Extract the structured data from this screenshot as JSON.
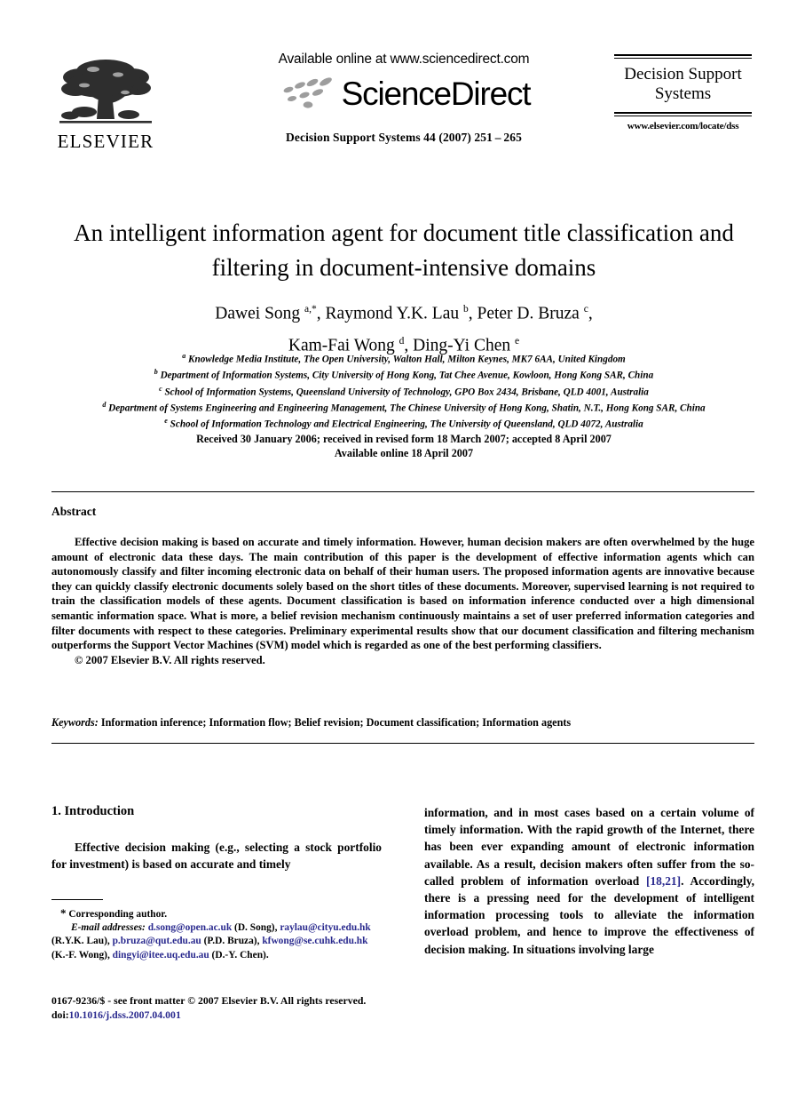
{
  "header": {
    "publisher_logo_text": "ELSEVIER",
    "available_online": "Available online at www.sciencedirect.com",
    "sciencedirect_wordmark": "ScienceDirect",
    "journal_citation": "Decision Support Systems 44 (2007) 251 – 265",
    "journal_title_line1": "Decision Support",
    "journal_title_line2": "Systems",
    "journal_url": "www.elsevier.com/locate/dss"
  },
  "article": {
    "title_line1": "An intelligent information agent for document title classification and",
    "title_line2": "filtering in document-intensive domains",
    "authors_line1_parts": [
      {
        "name": "Dawei Song ",
        "sup": "a,*"
      },
      {
        "name": ", Raymond Y.K. Lau ",
        "sup": "b"
      },
      {
        "name": ", Peter D. Bruza ",
        "sup": "c"
      },
      {
        "name": ",",
        "sup": ""
      }
    ],
    "authors_line2_parts": [
      {
        "name": "Kam-Fai Wong ",
        "sup": "d"
      },
      {
        "name": ", Ding-Yi Chen ",
        "sup": "e"
      }
    ],
    "affiliations": [
      {
        "marker": "a",
        "text": "Knowledge Media Institute, The Open University, Walton Hall, Milton Keynes, MK7 6AA, United Kingdom"
      },
      {
        "marker": "b",
        "text": "Department of Information Systems, City University of Hong Kong, Tat Chee Avenue, Kowloon, Hong Kong SAR, China"
      },
      {
        "marker": "c",
        "text": "School of Information Systems, Queensland University of Technology, GPO Box 2434, Brisbane, QLD 4001, Australia"
      },
      {
        "marker": "d",
        "text": "Department of Systems Engineering and Engineering Management, The Chinese University of Hong Kong, Shatin, N.T., Hong Kong SAR, China"
      },
      {
        "marker": "e",
        "text": "School of Information Technology and Electrical Engineering, The University of Queensland, QLD 4072, Australia"
      }
    ],
    "dates_line1": "Received 30 January 2006; received in revised form 18 March 2007; accepted 8 April 2007",
    "dates_line2": "Available online 18 April 2007"
  },
  "abstract": {
    "heading": "Abstract",
    "body": "Effective decision making is based on accurate and timely information. However, human decision makers are often overwhelmed by the huge amount of electronic data these days. The main contribution of this paper is the development of effective information agents which can autonomously classify and filter incoming electronic data on behalf of their human users. The proposed information agents are innovative because they can quickly classify electronic documents solely based on the short titles of these documents. Moreover, supervised learning is not required to train the classification models of these agents. Document classification is based on information inference conducted over a high dimensional semantic information space. What is more, a belief revision mechanism continuously maintains a set of user preferred information categories and filter documents with respect to these categories. Preliminary experimental results show that our document classification and filtering mechanism outperforms the Support Vector Machines (SVM) model which is regarded as one of the best performing classifiers.",
    "copyright": "© 2007 Elsevier B.V. All rights reserved."
  },
  "keywords": {
    "label": "Keywords:",
    "value": "Information inference; Information flow; Belief revision; Document classification; Information agents"
  },
  "introduction": {
    "heading": "1. Introduction",
    "left_paragraph": "Effective decision making (e.g., selecting a stock portfolio for investment) is based on accurate and timely",
    "right_before_cite": "information, and in most cases based on a certain volume of timely information. With the rapid growth of the Internet, there has been ever expanding amount of electronic information available. As a result, decision makers often suffer from the so-called problem of information overload ",
    "citation": "[18,21]",
    "right_after_cite": ". Accordingly, there is a pressing need for the development of intelligent information processing tools to alleviate the information overload problem, and hence to improve the effectiveness of decision making. In situations involving large"
  },
  "footnote": {
    "corresponding_marker": "*",
    "corresponding_text": "Corresponding author.",
    "email_label": "E-mail addresses:",
    "emails": [
      {
        "address": "d.song@open.ac.uk",
        "owner": "(D. Song),"
      },
      {
        "address": "raylau@cityu.edu.hk",
        "owner": "(R.Y.K. Lau),"
      },
      {
        "address": "p.bruza@qut.edu.au",
        "owner": "(P.D. Bruza),"
      },
      {
        "address": "kfwong@se.cuhk.edu.hk",
        "owner": "(K.-F. Wong),"
      },
      {
        "address": "dingyi@itee.uq.edu.au",
        "owner": "(D.-Y. Chen)."
      }
    ]
  },
  "imprint": {
    "issn_line": "0167-9236/$ - see front matter © 2007 Elsevier B.V. All rights reserved.",
    "doi_label": "doi:",
    "doi_value": "10.1016/j.dss.2007.04.001"
  },
  "colors": {
    "link": "#2b2b8f",
    "swoosh": "#9a9a9a",
    "text": "#000000"
  }
}
